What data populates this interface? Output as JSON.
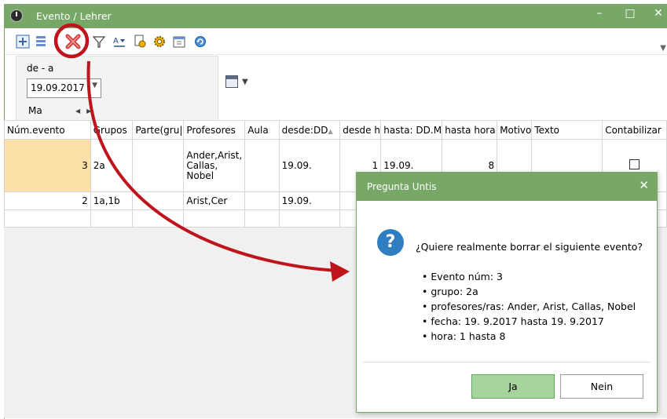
{
  "window": {
    "title": "Evento / Lehrer",
    "controls": {
      "minimize": "–",
      "maximize": "□",
      "close": "✕"
    }
  },
  "toolbar": {
    "icons": [
      "new-icon",
      "list-icon",
      "delete-icon",
      "filter-icon",
      "sort-icon",
      "print-icon",
      "settings-icon",
      "calendar-icon",
      "refresh-icon"
    ]
  },
  "filter": {
    "label": "de - a",
    "date_value": "19.09.2017",
    "weekday": "Ma"
  },
  "grid": {
    "columns": [
      "Núm.evento",
      "Grupos",
      "Parte(gru|",
      "Profesores",
      "Aula",
      "desde:DD",
      "desde h",
      "hasta: DD.M",
      "hasta hora",
      "Motivo",
      "Texto",
      "Contabilizar"
    ],
    "rows": [
      {
        "num": "3",
        "grupos": "2a",
        "parte": "",
        "profesores": "Ander,Arist, Callas, Nobel",
        "aula": "",
        "desde": "19.09.",
        "desde_h": "1",
        "hasta": "19.09.",
        "hasta_hora": "8",
        "motivo": "",
        "texto": ""
      },
      {
        "num": "2",
        "grupos": "1a,1b",
        "parte": "",
        "profesores": "Arist,Cer",
        "aula": "",
        "desde": "19.09.",
        "desde_h": "",
        "hasta": "",
        "hasta_hora": "",
        "motivo": "",
        "texto": ""
      }
    ]
  },
  "dialog": {
    "title": "Pregunta Untis",
    "close": "✕",
    "question": "¿Quiere realmente borrar el siguiente evento?",
    "details": [
      "Evento núm: 3",
      "grupo: 2a",
      "profesores/ras: Ander, Arist, Callas, Nobel",
      "fecha: 19. 9.2017 hasta 19. 9.2017",
      "hora: 1 hasta 8"
    ],
    "yes_label": "Ja",
    "no_label": "Nein"
  },
  "colors": {
    "titlebar": "#78a868",
    "annotation": "#c0141c",
    "highlight_cell": "#fde0a8",
    "yes_button": "#a7d39d"
  }
}
